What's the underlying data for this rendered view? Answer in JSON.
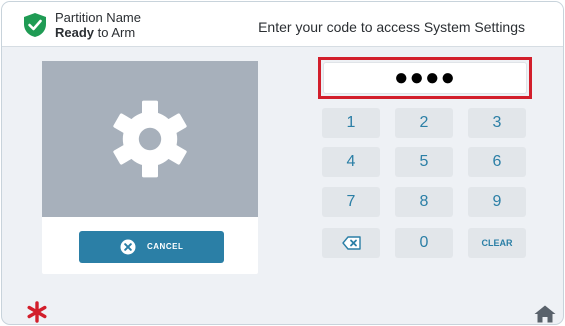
{
  "header": {
    "partition_name": "Partition Name",
    "status_bold": "Ready",
    "status_rest": " to Arm",
    "prompt": "Enter your code to access System Settings"
  },
  "pin": {
    "masked": "●●●●"
  },
  "keypad": {
    "k1": "1",
    "k2": "2",
    "k3": "3",
    "k4": "4",
    "k5": "5",
    "k6": "6",
    "k7": "7",
    "k8": "8",
    "k9": "9",
    "k0": "0",
    "clear": "CLEAR"
  },
  "cancel": {
    "label": "CANCEL"
  },
  "colors": {
    "accent": "#2b7fa6",
    "status_green": "#1f9b54",
    "alert_red": "#d21e2b",
    "home_gray": "#59626b"
  },
  "icons": {
    "status": "shield-check-icon",
    "settings": "gear-icon",
    "cancel": "circle-x-icon",
    "backspace": "backspace-icon",
    "alert": "asterisk-icon",
    "home": "home-icon"
  }
}
